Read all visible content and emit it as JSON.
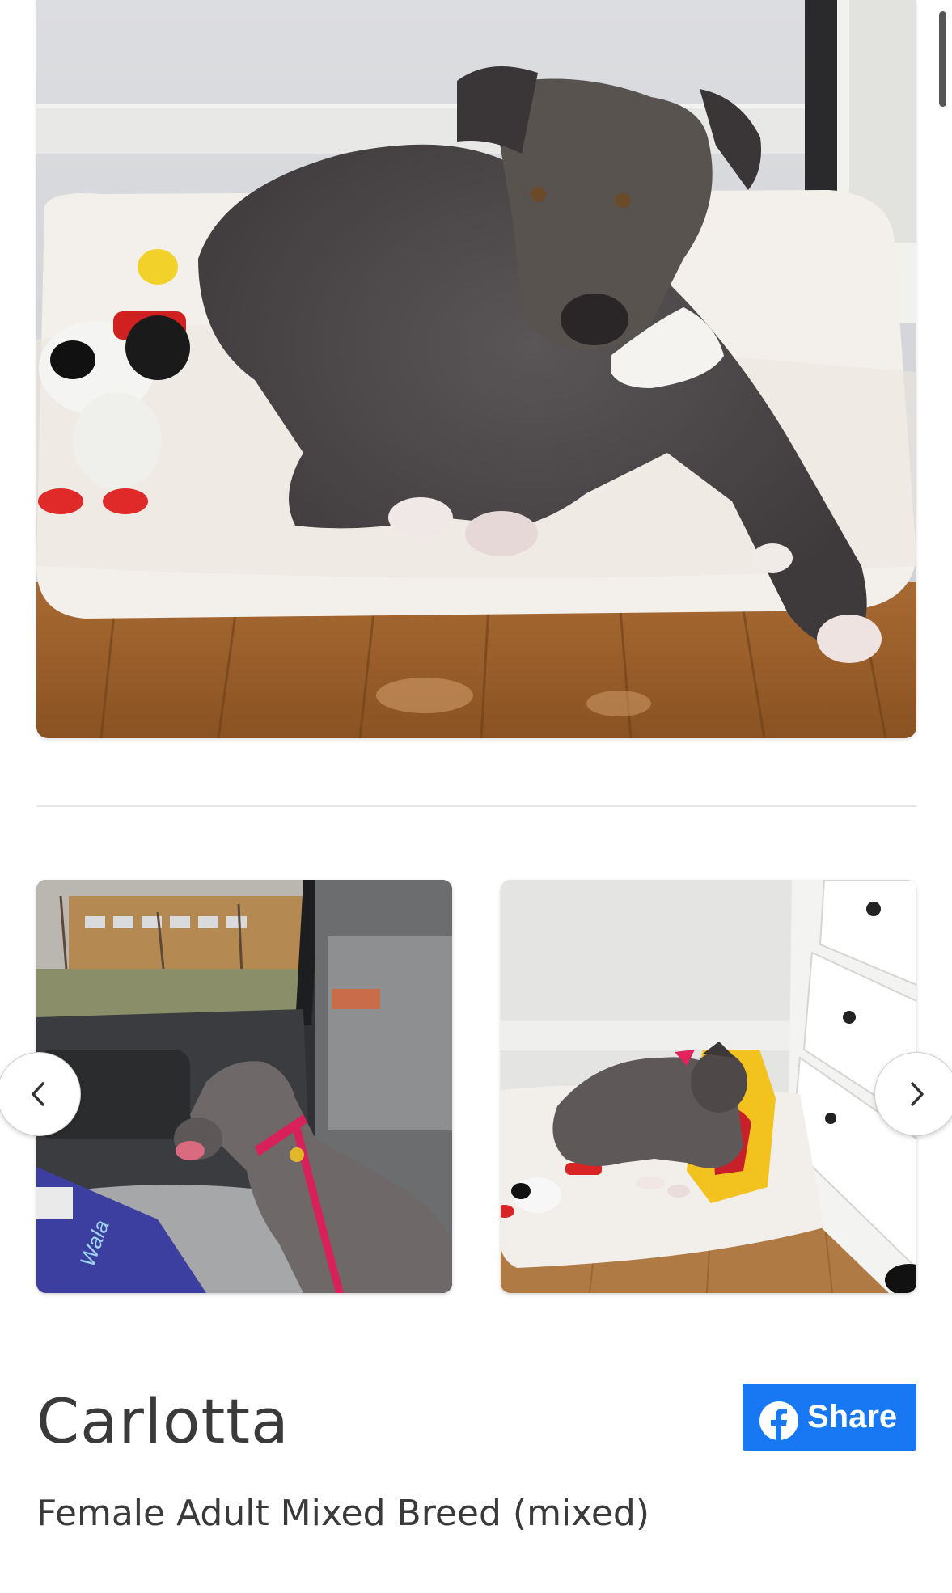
{
  "pet": {
    "name": "Carlotta",
    "description": "Female Adult Mixed Breed (mixed)"
  },
  "share_button": {
    "label": "Share",
    "icon": "facebook-icon",
    "color": "#1877f2"
  },
  "carousel": {
    "prev_icon": "chevron-left-icon",
    "next_icon": "chevron-right-icon"
  },
  "thumbnails": {
    "thumb1_decal_text": "Wala"
  }
}
